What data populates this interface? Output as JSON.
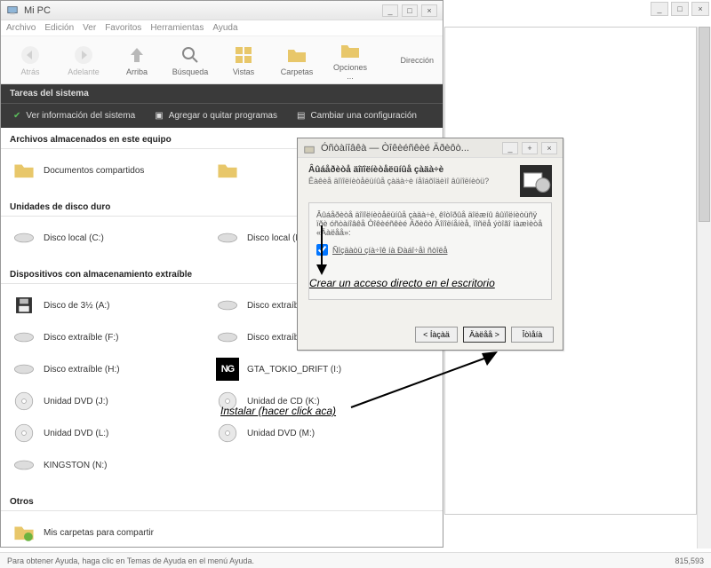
{
  "outer": {
    "min": "_",
    "max": "□",
    "close": "×"
  },
  "window": {
    "title": "Mi PC",
    "min": "_",
    "max": "□",
    "close": "×"
  },
  "menu": [
    "Archivo",
    "Edición",
    "Ver",
    "Favoritos",
    "Herramientas",
    "Ayuda"
  ],
  "toolbar": {
    "back": "Atrás",
    "fwd": "Adelante",
    "up": "Arriba",
    "search": "Búsqueda",
    "views": "Vistas",
    "folders": "Carpetas",
    "options": "Opciones ...",
    "direction": "Dirección"
  },
  "sysbar": {
    "header": "Tareas del sistema",
    "info": "Ver información del sistema",
    "addremove": "Agregar o quitar programas",
    "change": "Cambiar una configuración"
  },
  "sections": {
    "stored": "Archivos almacenados en este equipo",
    "hdd": "Unidades de disco duro",
    "removable": "Dispositivos con almacenamiento extraíble",
    "other": "Otros"
  },
  "items": {
    "shared": "Documentos compartidos",
    "c": "Disco local (C:)",
    "d": "Disco local (D:)",
    "a": "Disco de 3½ (A:)",
    "e": "Disco extraíble (E:)",
    "f": "Disco extraíble (F:)",
    "g": "Disco extraíble (G:)",
    "h": "Disco extraíble (H:)",
    "i": "GTA_TOKIO_DRIFT (I:)",
    "j": "Unidad DVD (J:)",
    "k": "Unidad de CD (K:)",
    "l": "Unidad DVD (L:)",
    "m": "Unidad DVD (M:)",
    "n": "KINGSTON (N:)",
    "myfolders": "Mis carpetas para compartir"
  },
  "status": {
    "help": "Para obtener Ayuda, haga clic en Temas de Ayuda en el menú Ayuda.",
    "coords": "815,593"
  },
  "dialog": {
    "title": "Óñòàíîâêà — Òîêèéñêèé Äðèôò...",
    "min": "_",
    "plus": "+",
    "close": "×",
    "heading": "Âûáåðèòå äîïîëíèòåëüíûå çàäà÷è",
    "subheading": "Êàêèå äîïîëíèòåëüíûå çàäà÷è íåîáõîäèìî âûïîëíèòü?",
    "para": "Âûáåðèòå äîïîëíèòåëüíûå çàäà÷è, êîòîðûå äîëæíû âûïîëíèòüñÿ ïðè óñòàíîâêå Òîêèéñêèé Äðèôò Äîïîëíåíèå, ïîñëå ýòîãî íàæìèòå «Äàëåå»:",
    "checkbox": "Ñîçäàòü çíà÷îê íà Ðàáî÷åì ñòîëå",
    "btn_back": "< Íàçàä",
    "btn_next": "Äàëåå >",
    "btn_cancel": "Îòìåíà"
  },
  "annotations": {
    "desktop": "Crear un acceso directo en el escritorio",
    "install": "Instalar (hacer click aca)"
  },
  "ng": "NG"
}
